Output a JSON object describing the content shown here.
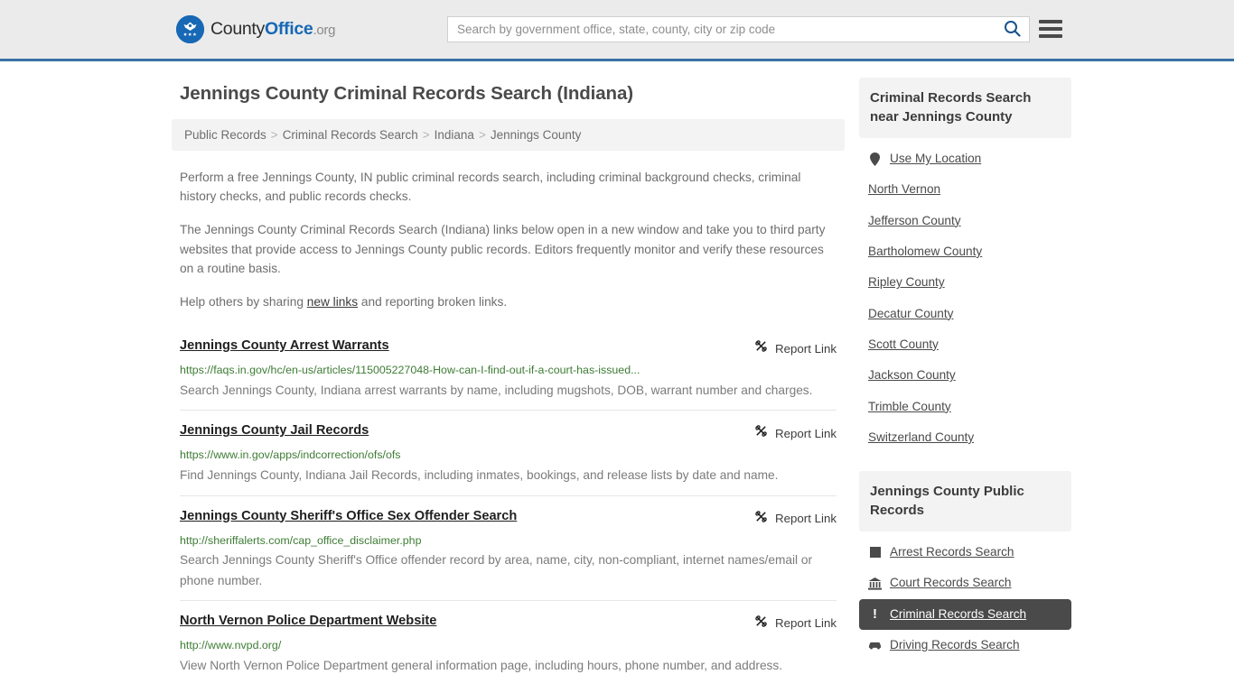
{
  "header": {
    "logo": {
      "part1": "County",
      "part2": "Office",
      "part3": ".org",
      "icon": "eagle-seal-logo"
    },
    "search": {
      "placeholder": "Search by government office, state, county, city or zip code",
      "value": "",
      "search_icon": "search-icon"
    },
    "menu_icon": "hamburger-menu-icon",
    "accent_color": "#3a72a6",
    "background_color": "#ebebeb"
  },
  "main": {
    "title": "Jennings County Criminal Records Search (Indiana)",
    "breadcrumb": [
      "Public Records",
      "Criminal Records Search",
      "Indiana",
      "Jennings County"
    ],
    "breadcrumb_separator": ">",
    "intro": {
      "p1": "Perform a free Jennings County, IN public criminal records search, including criminal background checks, criminal history checks, and public records checks.",
      "p2": "The Jennings County Criminal Records Search (Indiana) links below open in a new window and take you to third party websites that provide access to Jennings County public records. Editors frequently monitor and verify these resources on a routine basis.",
      "p3_before": "Help others by sharing ",
      "p3_link": "new links",
      "p3_after": " and reporting broken links."
    },
    "report_link_label": "Report Link",
    "report_link_icon": "broken-link-icon",
    "results": [
      {
        "title": "Jennings County Arrest Warrants",
        "url": "https://faqs.in.gov/hc/en-us/articles/115005227048-How-can-I-find-out-if-a-court-has-issued...",
        "description": "Search Jennings County, Indiana arrest warrants by name, including mugshots, DOB, warrant number and charges."
      },
      {
        "title": "Jennings County Jail Records",
        "url": "https://www.in.gov/apps/indcorrection/ofs/ofs",
        "description": "Find Jennings County, Indiana Jail Records, including inmates, bookings, and release lists by date and name."
      },
      {
        "title": "Jennings County Sheriff's Office Sex Offender Search",
        "url": "http://sheriffalerts.com/cap_office_disclaimer.php",
        "description": "Search Jennings County Sheriff's Office offender record by area, name, city, non-compliant, internet names/email or phone number."
      },
      {
        "title": "North Vernon Police Department Website",
        "url": "http://www.nvpd.org/",
        "description": "View North Vernon Police Department general information page, including hours, phone number, and address."
      }
    ]
  },
  "sidebar": {
    "nearby": {
      "heading": "Criminal Records Search near Jennings County",
      "items": [
        {
          "label": "Use My Location",
          "icon": "map-pin-icon"
        },
        {
          "label": "North Vernon",
          "icon": ""
        },
        {
          "label": "Jefferson County",
          "icon": ""
        },
        {
          "label": "Bartholomew County",
          "icon": ""
        },
        {
          "label": "Ripley County",
          "icon": ""
        },
        {
          "label": "Decatur County",
          "icon": ""
        },
        {
          "label": "Scott County",
          "icon": ""
        },
        {
          "label": "Jackson County",
          "icon": ""
        },
        {
          "label": "Trimble County",
          "icon": ""
        },
        {
          "label": "Switzerland County",
          "icon": ""
        }
      ]
    },
    "public_records": {
      "heading": "Jennings County Public Records",
      "active_index": 2,
      "items": [
        {
          "label": "Arrest Records Search",
          "icon": "fingerprint-icon"
        },
        {
          "label": "Court Records Search",
          "icon": "courthouse-icon"
        },
        {
          "label": "Criminal Records Search",
          "icon": "exclamation-icon"
        },
        {
          "label": "Driving Records Search",
          "icon": "car-icon"
        }
      ]
    },
    "active_background": "#4a4a4a"
  }
}
